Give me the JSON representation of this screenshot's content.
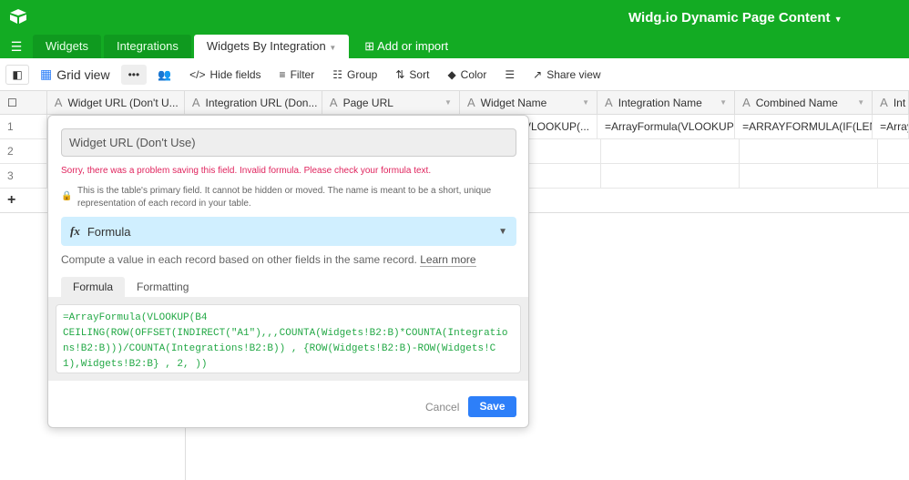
{
  "app": {
    "title": "Widg.io Dynamic Page Content",
    "brand_color": "#13ab23"
  },
  "tabs": [
    {
      "label": "Widgets"
    },
    {
      "label": "Integrations"
    },
    {
      "label": "Widgets By Integration"
    }
  ],
  "add_import": "Add or import",
  "toolbar": {
    "view": "Grid view",
    "hide_fields": "Hide fields",
    "filter": "Filter",
    "group": "Group",
    "sort": "Sort",
    "color": "Color",
    "share": "Share view"
  },
  "columns": [
    "Widget URL (Don't U...",
    "Integration URL (Don...",
    "Page URL",
    "Widget Name",
    "Integration Name",
    "Combined Name",
    "Int"
  ],
  "rows": [
    {
      "num": "1",
      "cells": [
        "",
        "",
        "",
        "a(VLOOKUP(...",
        "=ArrayFormula(VLOOKUP(...",
        "=ARRAYFORMULA(IF(LEN(...",
        "=Array"
      ]
    },
    {
      "num": "2",
      "cells": [
        "",
        "",
        "",
        "",
        "",
        "",
        ""
      ]
    },
    {
      "num": "3",
      "cells": [
        "",
        "",
        "",
        "",
        "",
        "",
        ""
      ]
    }
  ],
  "add_row": "+",
  "dialog": {
    "field_name": "Widget URL (Don't Use)",
    "error": "Sorry, there was a problem saving this field. Invalid formula. Please check your formula text.",
    "primary_note": "This is the table's primary field. It cannot be hidden or moved. The name is meant to be a short, unique representation of each record in your table.",
    "type": "Formula",
    "description": "Compute a value in each record based on other fields in the same record.",
    "learn_more": "Learn more",
    "tabs": [
      "Formula",
      "Formatting"
    ],
    "formula": "=ArrayFormula(VLOOKUP(B4\nCEILING(ROW(OFFSET(INDIRECT(\"A1\"),,,COUNTA(Widgets!B2:B)*COUNTA(Integrations!B2:B)))/COUNTA(Integrations!B2:B)) , {ROW(Widgets!B2:B)-ROW(Widgets!C1),Widgets!B2:B} , 2, ))",
    "cancel": "Cancel",
    "save": "Save"
  }
}
